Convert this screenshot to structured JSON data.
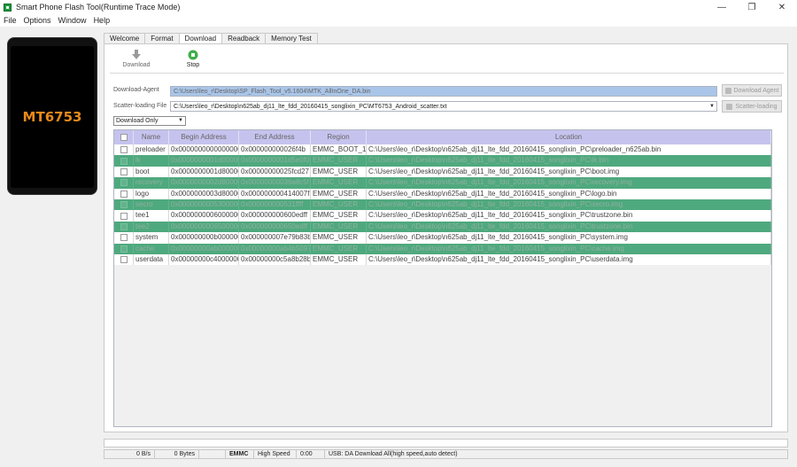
{
  "window": {
    "title": "Smart Phone Flash Tool(Runtime Trace Mode)",
    "controls": {
      "minimize": "—",
      "maximize": "❐",
      "close": "✕"
    }
  },
  "menu": [
    "File",
    "Options",
    "Window",
    "Help"
  ],
  "phone": {
    "model": "MT6753"
  },
  "tabs": [
    {
      "label": "Welcome",
      "active": false
    },
    {
      "label": "Format",
      "active": false
    },
    {
      "label": "Download",
      "active": true
    },
    {
      "label": "Readback",
      "active": false
    },
    {
      "label": "Memory Test",
      "active": false
    }
  ],
  "toolbar": {
    "download_label": "Download",
    "stop_label": "Stop"
  },
  "download_agent": {
    "label": "Download-Agent",
    "value": "C:\\Users\\leo_r\\Desktop\\SP_Flash_Tool_v5.1604\\MTK_AllInOne_DA.bin",
    "button": "Download Agent"
  },
  "scatter": {
    "label": "Scatter-loading File",
    "value": "C:\\Users\\leo_r\\Desktop\\n625ab_dj11_lte_fdd_20160415_songlixin_PC\\MT6753_Android_scatter.txt",
    "button": "Scatter-loading"
  },
  "mode": {
    "selected": "Download Only"
  },
  "table": {
    "headers": [
      "",
      "Name",
      "Begin Address",
      "End Address",
      "Region",
      "Location"
    ],
    "rows": [
      {
        "name": "preloader",
        "begin": "0x0000000000000000",
        "end": "0x000000000026f4b",
        "region": "EMMC_BOOT_1",
        "location": "C:\\Users\\leo_r\\Desktop\\n625ab_dj11_lte_fdd_20160415_songlixin_PC\\preloader_n625ab.bin"
      },
      {
        "name": "lk",
        "begin": "0x0000000001d00000",
        "end": "0x0000000001d5e0f0",
        "region": "EMMC_USER",
        "location": "C:\\Users\\leo_r\\Desktop\\n625ab_dj11_lte_fdd_20160415_songlixin_PC\\lk.bin"
      },
      {
        "name": "boot",
        "begin": "0x0000000001d80000",
        "end": "0x00000000025fcd27",
        "region": "EMMC_USER",
        "location": "C:\\Users\\leo_r\\Desktop\\n625ab_dj11_lte_fdd_20160415_songlixin_PC\\boot.img"
      },
      {
        "name": "recovery",
        "begin": "0x0000000002d80000",
        "end": "0x00000000036a8c5f",
        "region": "EMMC_USER",
        "location": "C:\\Users\\leo_r\\Desktop\\n625ab_dj11_lte_fdd_20160415_songlixin_PC\\recovery.img"
      },
      {
        "name": "logo",
        "begin": "0x0000000003d80000",
        "end": "0x000000000414007f",
        "region": "EMMC_USER",
        "location": "C:\\Users\\leo_r\\Desktop\\n625ab_dj11_lte_fdd_20160415_songlixin_PC\\logo.bin"
      },
      {
        "name": "secro",
        "begin": "0x0000000005300000",
        "end": "0x000000000531ffff",
        "region": "EMMC_USER",
        "location": "C:\\Users\\leo_r\\Desktop\\n625ab_dj11_lte_fdd_20160415_songlixin_PC\\secro.img"
      },
      {
        "name": "tee1",
        "begin": "0x0000000006000000",
        "end": "0x000000000600edff",
        "region": "EMMC_USER",
        "location": "C:\\Users\\leo_r\\Desktop\\n625ab_dj11_lte_fdd_20160415_songlixin_PC\\trustzone.bin"
      },
      {
        "name": "tee2",
        "begin": "0x0000000006500000",
        "end": "0x000000000650edff",
        "region": "EMMC_USER",
        "location": "C:\\Users\\leo_r\\Desktop\\n625ab_dj11_lte_fdd_20160415_songlixin_PC\\trustzone.bin"
      },
      {
        "name": "system",
        "begin": "0x000000000b000000",
        "end": "0x000000007e79b83b",
        "region": "EMMC_USER",
        "location": "C:\\Users\\leo_r\\Desktop\\n625ab_dj11_lte_fdd_20160415_songlixin_PC\\system.img"
      },
      {
        "name": "cache",
        "begin": "0x00000000ab000000",
        "end": "0x00000000ab4b5097",
        "region": "EMMC_USER",
        "location": "C:\\Users\\leo_r\\Desktop\\n625ab_dj11_lte_fdd_20160415_songlixin_PC\\cache.img"
      },
      {
        "name": "userdata",
        "begin": "0x00000000c4000000",
        "end": "0x00000000c5a8b28b",
        "region": "EMMC_USER",
        "location": "C:\\Users\\leo_r\\Desktop\\n625ab_dj11_lte_fdd_20160415_songlixin_PC\\userdata.img"
      }
    ]
  },
  "status": {
    "speed": "0 B/s",
    "bytes": "0 Bytes",
    "storage": "EMMC",
    "mode": "High Speed",
    "time": "0:00",
    "usb": "USB: DA Download All(high speed,auto detect)"
  },
  "colors": {
    "accent_header": "#c5c3ee",
    "row_highlight": "#4fa97e",
    "agent_field": "#a9c5e8",
    "chip_label": "#e88a1a"
  }
}
